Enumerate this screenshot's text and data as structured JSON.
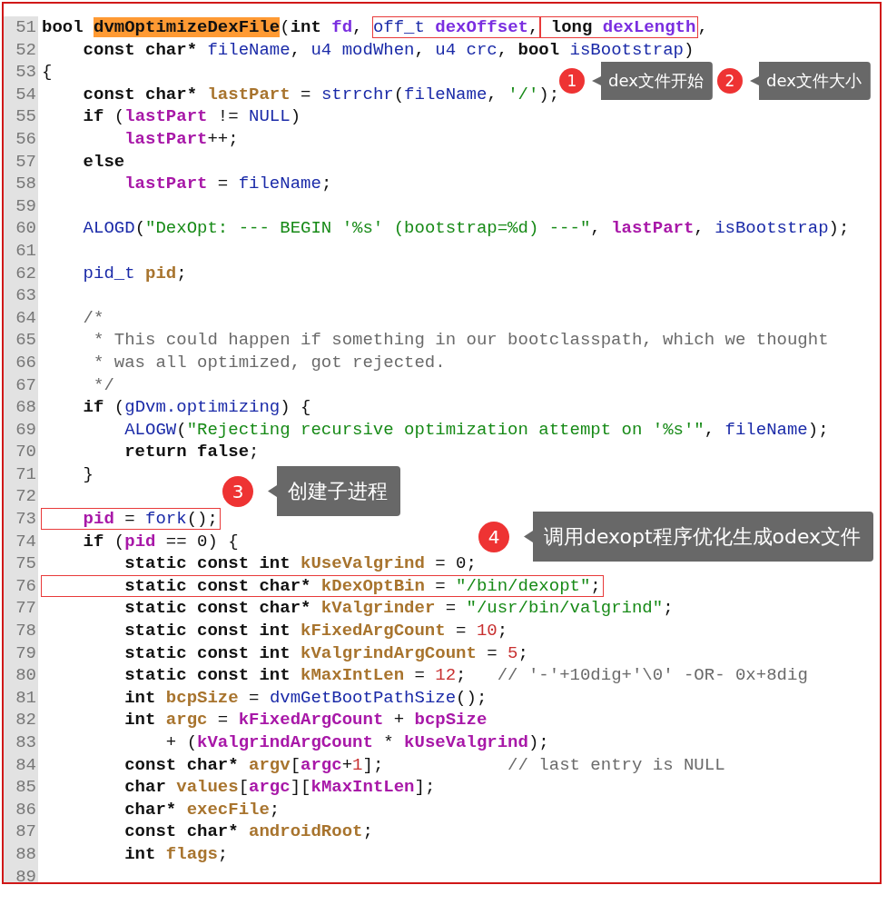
{
  "editor": {
    "lines": [
      {
        "number": "51",
        "tokens": [
          {
            "kind": "keyword",
            "text": "bool "
          },
          {
            "kind": "highlight",
            "text": "dvmOptimizeDexFile"
          },
          {
            "kind": "plain",
            "text": "("
          },
          {
            "kind": "keyword",
            "text": "int "
          },
          {
            "kind": "param",
            "text": "fd"
          },
          {
            "kind": "plain",
            "text": ", "
          },
          {
            "kind": "box",
            "tokens": [
              {
                "kind": "func",
                "text": "off_t "
              },
              {
                "kind": "param",
                "text": "dexOffset"
              },
              {
                "kind": "plain",
                "text": ","
              }
            ]
          },
          {
            "kind": "box",
            "tokens": [
              {
                "kind": "keyword",
                "text": " long "
              },
              {
                "kind": "param",
                "text": "dexLength"
              }
            ]
          },
          {
            "kind": "plain",
            "text": ","
          }
        ]
      },
      {
        "number": "52",
        "tokens": [
          {
            "kind": "keyword",
            "text": "    const char* "
          },
          {
            "kind": "func",
            "text": "fileName"
          },
          {
            "kind": "plain",
            "text": ", "
          },
          {
            "kind": "func",
            "text": "u4 modWhen"
          },
          {
            "kind": "plain",
            "text": ", "
          },
          {
            "kind": "func",
            "text": "u4 crc"
          },
          {
            "kind": "plain",
            "text": ", "
          },
          {
            "kind": "keyword",
            "text": "bool "
          },
          {
            "kind": "func",
            "text": "isBootstrap"
          },
          {
            "kind": "plain",
            "text": ")"
          }
        ]
      },
      {
        "number": "53",
        "tokens": [
          {
            "kind": "plain",
            "text": "{"
          }
        ]
      },
      {
        "number": "54",
        "tokens": [
          {
            "kind": "keyword",
            "text": "    const char* "
          },
          {
            "kind": "local",
            "text": "lastPart"
          },
          {
            "kind": "plain",
            "text": " = "
          },
          {
            "kind": "func",
            "text": "strrchr"
          },
          {
            "kind": "plain",
            "text": "("
          },
          {
            "kind": "func",
            "text": "fileName"
          },
          {
            "kind": "plain",
            "text": ", "
          },
          {
            "kind": "string",
            "text": "'/'"
          },
          {
            "kind": "plain",
            "text": ");"
          }
        ]
      },
      {
        "number": "55",
        "tokens": [
          {
            "kind": "keyword",
            "text": "    if "
          },
          {
            "kind": "plain",
            "text": "("
          },
          {
            "kind": "var",
            "text": "lastPart"
          },
          {
            "kind": "plain",
            "text": " != "
          },
          {
            "kind": "func",
            "text": "NULL"
          },
          {
            "kind": "plain",
            "text": ")"
          }
        ]
      },
      {
        "number": "56",
        "tokens": [
          {
            "kind": "var",
            "text": "        lastPart"
          },
          {
            "kind": "plain",
            "text": "++;"
          }
        ]
      },
      {
        "number": "57",
        "tokens": [
          {
            "kind": "keyword",
            "text": "    else"
          }
        ]
      },
      {
        "number": "58",
        "tokens": [
          {
            "kind": "var",
            "text": "        lastPart"
          },
          {
            "kind": "plain",
            "text": " = "
          },
          {
            "kind": "func",
            "text": "fileName"
          },
          {
            "kind": "plain",
            "text": ";"
          }
        ]
      },
      {
        "number": "59"
      },
      {
        "number": "60",
        "tokens": [
          {
            "kind": "func",
            "text": "    ALOGD"
          },
          {
            "kind": "plain",
            "text": "("
          },
          {
            "kind": "string",
            "text": "\"DexOpt: --- BEGIN '%s' (bootstrap=%d) ---\""
          },
          {
            "kind": "plain",
            "text": ", "
          },
          {
            "kind": "var",
            "text": "lastPart"
          },
          {
            "kind": "plain",
            "text": ", "
          },
          {
            "kind": "func",
            "text": "isBootstrap"
          },
          {
            "kind": "plain",
            "text": ");"
          }
        ]
      },
      {
        "number": "61"
      },
      {
        "number": "62",
        "tokens": [
          {
            "kind": "func",
            "text": "    pid_t "
          },
          {
            "kind": "local",
            "text": "pid"
          },
          {
            "kind": "plain",
            "text": ";"
          }
        ]
      },
      {
        "number": "63"
      },
      {
        "number": "64",
        "tokens": [
          {
            "kind": "comment",
            "text": "    /*"
          }
        ]
      },
      {
        "number": "65",
        "tokens": [
          {
            "kind": "comment",
            "text": "     * This could happen if something in our bootclasspath, which we thought"
          }
        ]
      },
      {
        "number": "66",
        "tokens": [
          {
            "kind": "comment",
            "text": "     * was all optimized, got rejected."
          }
        ]
      },
      {
        "number": "67",
        "tokens": [
          {
            "kind": "comment",
            "text": "     */"
          }
        ]
      },
      {
        "number": "68",
        "tokens": [
          {
            "kind": "keyword",
            "text": "    if "
          },
          {
            "kind": "plain",
            "text": "("
          },
          {
            "kind": "func",
            "text": "gDvm.optimizing"
          },
          {
            "kind": "plain",
            "text": ") {"
          }
        ]
      },
      {
        "number": "69",
        "tokens": [
          {
            "kind": "func",
            "text": "        ALOGW"
          },
          {
            "kind": "plain",
            "text": "("
          },
          {
            "kind": "string",
            "text": "\"Rejecting recursive optimization attempt on '%s'\""
          },
          {
            "kind": "plain",
            "text": ", "
          },
          {
            "kind": "func",
            "text": "fileName"
          },
          {
            "kind": "plain",
            "text": ");"
          }
        ]
      },
      {
        "number": "70",
        "tokens": [
          {
            "kind": "keyword",
            "text": "        return false"
          },
          {
            "kind": "plain",
            "text": ";"
          }
        ]
      },
      {
        "number": "71",
        "tokens": [
          {
            "kind": "plain",
            "text": "    }"
          }
        ]
      },
      {
        "number": "72"
      },
      {
        "number": "73",
        "tokens": [
          {
            "kind": "box",
            "tokens": [
              {
                "kind": "var",
                "text": "    pid"
              },
              {
                "kind": "plain",
                "text": " = "
              },
              {
                "kind": "func",
                "text": "fork"
              },
              {
                "kind": "plain",
                "text": "();"
              }
            ]
          }
        ]
      },
      {
        "number": "74",
        "tokens": [
          {
            "kind": "keyword",
            "text": "    if "
          },
          {
            "kind": "plain",
            "text": "("
          },
          {
            "kind": "var",
            "text": "pid"
          },
          {
            "kind": "plain",
            "text": " == 0) {"
          }
        ]
      },
      {
        "number": "75",
        "tokens": [
          {
            "kind": "keyword",
            "text": "        static const int "
          },
          {
            "kind": "local",
            "text": "kUseValgrind"
          },
          {
            "kind": "plain",
            "text": " = 0;"
          }
        ]
      },
      {
        "number": "76",
        "tokens": [
          {
            "kind": "box",
            "tokens": [
              {
                "kind": "keyword",
                "text": "        static const char* "
              },
              {
                "kind": "local",
                "text": "kDexOptBin"
              },
              {
                "kind": "plain",
                "text": " = "
              },
              {
                "kind": "string",
                "text": "\"/bin/dexopt\""
              },
              {
                "kind": "plain",
                "text": ";"
              }
            ]
          }
        ]
      },
      {
        "number": "77",
        "tokens": [
          {
            "kind": "keyword",
            "text": "        static const char* "
          },
          {
            "kind": "local",
            "text": "kValgrinder"
          },
          {
            "kind": "plain",
            "text": " = "
          },
          {
            "kind": "string",
            "text": "\"/usr/bin/valgrind\""
          },
          {
            "kind": "plain",
            "text": ";"
          }
        ]
      },
      {
        "number": "78",
        "tokens": [
          {
            "kind": "keyword",
            "text": "        static const int "
          },
          {
            "kind": "local",
            "text": "kFixedArgCount"
          },
          {
            "kind": "plain",
            "text": " = "
          },
          {
            "kind": "number",
            "text": "10"
          },
          {
            "kind": "plain",
            "text": ";"
          }
        ]
      },
      {
        "number": "79",
        "tokens": [
          {
            "kind": "keyword",
            "text": "        static const int "
          },
          {
            "kind": "local",
            "text": "kValgrindArgCount"
          },
          {
            "kind": "plain",
            "text": " = "
          },
          {
            "kind": "number",
            "text": "5"
          },
          {
            "kind": "plain",
            "text": ";"
          }
        ]
      },
      {
        "number": "80",
        "tokens": [
          {
            "kind": "keyword",
            "text": "        static const int "
          },
          {
            "kind": "local",
            "text": "kMaxIntLen"
          },
          {
            "kind": "plain",
            "text": " = "
          },
          {
            "kind": "number",
            "text": "12"
          },
          {
            "kind": "plain",
            "text": ";"
          },
          {
            "kind": "comment",
            "text": "   // '-'+10dig+'\\0' -OR- 0x+8dig"
          }
        ]
      },
      {
        "number": "81",
        "tokens": [
          {
            "kind": "keyword",
            "text": "        int "
          },
          {
            "kind": "local",
            "text": "bcpSize"
          },
          {
            "kind": "plain",
            "text": " = "
          },
          {
            "kind": "func",
            "text": "dvmGetBootPathSize"
          },
          {
            "kind": "plain",
            "text": "();"
          }
        ]
      },
      {
        "number": "82",
        "tokens": [
          {
            "kind": "keyword",
            "text": "        int "
          },
          {
            "kind": "local",
            "text": "argc"
          },
          {
            "kind": "plain",
            "text": " = "
          },
          {
            "kind": "var",
            "text": "kFixedArgCount"
          },
          {
            "kind": "plain",
            "text": " + "
          },
          {
            "kind": "var",
            "text": "bcpSize"
          }
        ]
      },
      {
        "number": "83",
        "tokens": [
          {
            "kind": "plain",
            "text": "            + ("
          },
          {
            "kind": "var",
            "text": "kValgrindArgCount"
          },
          {
            "kind": "plain",
            "text": " * "
          },
          {
            "kind": "var",
            "text": "kUseValgrind"
          },
          {
            "kind": "plain",
            "text": ");"
          }
        ]
      },
      {
        "number": "84",
        "tokens": [
          {
            "kind": "keyword",
            "text": "        const char* "
          },
          {
            "kind": "local",
            "text": "argv"
          },
          {
            "kind": "plain",
            "text": "["
          },
          {
            "kind": "var",
            "text": "argc"
          },
          {
            "kind": "plain",
            "text": "+"
          },
          {
            "kind": "number",
            "text": "1"
          },
          {
            "kind": "plain",
            "text": "];"
          },
          {
            "kind": "comment",
            "text": "            // last entry is NULL"
          }
        ]
      },
      {
        "number": "85",
        "tokens": [
          {
            "kind": "keyword",
            "text": "        char "
          },
          {
            "kind": "local",
            "text": "values"
          },
          {
            "kind": "plain",
            "text": "["
          },
          {
            "kind": "var",
            "text": "argc"
          },
          {
            "kind": "plain",
            "text": "]["
          },
          {
            "kind": "var",
            "text": "kMaxIntLen"
          },
          {
            "kind": "plain",
            "text": "];"
          }
        ]
      },
      {
        "number": "86",
        "tokens": [
          {
            "kind": "keyword",
            "text": "        char* "
          },
          {
            "kind": "local",
            "text": "execFile"
          },
          {
            "kind": "plain",
            "text": ";"
          }
        ]
      },
      {
        "number": "87",
        "tokens": [
          {
            "kind": "keyword",
            "text": "        const char* "
          },
          {
            "kind": "local",
            "text": "androidRoot"
          },
          {
            "kind": "plain",
            "text": ";"
          }
        ]
      },
      {
        "number": "88",
        "tokens": [
          {
            "kind": "keyword",
            "text": "        int "
          },
          {
            "kind": "local",
            "text": "flags"
          },
          {
            "kind": "plain",
            "text": ";"
          }
        ]
      },
      {
        "number": "89"
      }
    ]
  },
  "callouts": [
    {
      "number": "1",
      "text": "dex文件开始"
    },
    {
      "number": "2",
      "text": "dex文件大小"
    },
    {
      "number": "3",
      "text": "创建子进程"
    },
    {
      "number": "4",
      "text": "调用dexopt程序优化生成odex文件"
    }
  ]
}
